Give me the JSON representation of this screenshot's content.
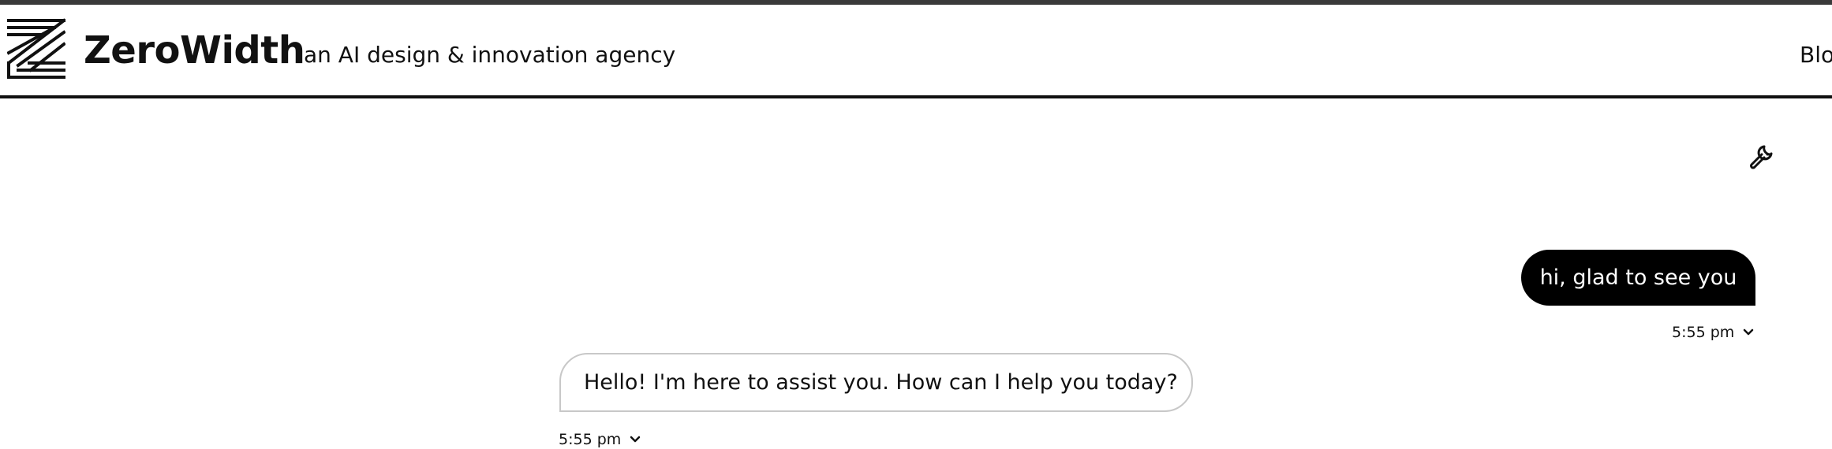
{
  "header": {
    "brand_name": "ZeroWidth",
    "tagline": "an AI design & innovation agency",
    "nav_blog": "Blo"
  },
  "toolbar": {
    "settings_icon": "wrench-icon"
  },
  "messages": [
    {
      "role": "user",
      "text": "hi, glad to see you",
      "time": "5:55 pm"
    },
    {
      "role": "assistant",
      "text": "Hello! I'm here to assist you. How can I help you today?",
      "time": "5:55 pm"
    }
  ],
  "colors": {
    "user_bubble_bg": "#000000",
    "user_bubble_text": "#ffffff",
    "assistant_bubble_border": "#c8c8c8",
    "header_rule": "#111111"
  }
}
